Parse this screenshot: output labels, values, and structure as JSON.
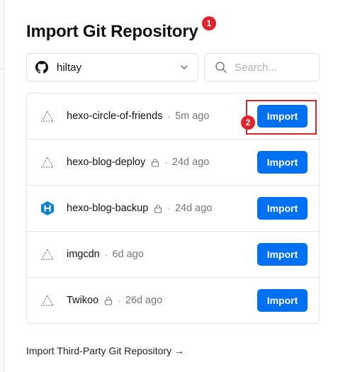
{
  "page": {
    "title": "Import Git Repository",
    "third_party_link": "Import Third-Party Git Repository →"
  },
  "badges": {
    "first": "1",
    "second": "2"
  },
  "account_select": {
    "icon": "github-icon",
    "value": "hiltay"
  },
  "search": {
    "placeholder": "Search...",
    "value": ""
  },
  "repos": [
    {
      "name": "hexo-circle-of-friends",
      "private": false,
      "age": "5m ago",
      "icon": "triangle-dotted-icon",
      "import_label": "Import"
    },
    {
      "name": "hexo-blog-deploy",
      "private": true,
      "age": "24d ago",
      "icon": "triangle-dotted-icon",
      "import_label": "Import"
    },
    {
      "name": "hexo-blog-backup",
      "private": true,
      "age": "24d ago",
      "icon": "hexo-icon",
      "import_label": "Import"
    },
    {
      "name": "imgcdn",
      "private": false,
      "age": "6d ago",
      "icon": "triangle-dotted-icon",
      "import_label": "Import"
    },
    {
      "name": "Twikoo",
      "private": true,
      "age": "26d ago",
      "icon": "triangle-dotted-icon",
      "import_label": "Import"
    }
  ],
  "separator": "·",
  "colors": {
    "accent": "#0070f3",
    "annotation": "#e0242c",
    "hexo_brand": "#0e83cd"
  }
}
